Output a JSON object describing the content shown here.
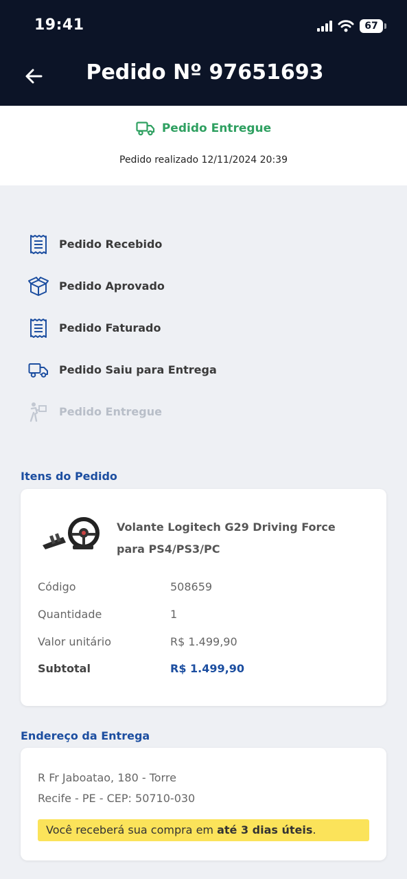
{
  "status_bar": {
    "time": "19:41",
    "battery": "67",
    "icons": [
      "signal-icon",
      "wifi-icon",
      "battery-icon"
    ]
  },
  "header": {
    "title": "Pedido Nº 97651693",
    "back_icon": "back-arrow-icon"
  },
  "order_status": {
    "label": "Pedido Entregue",
    "date_text": "Pedido realizado 12/11/2024 20:39",
    "color": "#2fa061"
  },
  "timeline": [
    {
      "label": "Pedido Recebido",
      "icon": "receipt-icon",
      "state": "done"
    },
    {
      "label": "Pedido Aprovado",
      "icon": "box-icon",
      "state": "done"
    },
    {
      "label": "Pedido Faturado",
      "icon": "invoice-icon",
      "state": "done"
    },
    {
      "label": "Pedido Saiu para Entrega",
      "icon": "truck-icon",
      "state": "done"
    },
    {
      "label": "Pedido Entregue",
      "icon": "delivery-person-icon",
      "state": "pending"
    }
  ],
  "items_section": {
    "title": "Itens do Pedido",
    "product": {
      "name_line1": "Volante Logitech G29 Driving Force",
      "name_line2": "para PS4/PS3/PC",
      "image": "steering-wheel-image"
    },
    "details": [
      {
        "key": "Código",
        "value": "508659"
      },
      {
        "key": "Quantidade",
        "value": "1"
      },
      {
        "key": "Valor unitário",
        "value": "R$ 1.499,90"
      }
    ],
    "subtotal": {
      "key": "Subtotal",
      "value": "R$ 1.499,90"
    }
  },
  "address_section": {
    "title": "Endereço da Entrega",
    "line1": "R Fr Jaboatao, 180 - Torre",
    "line2": "Recife - PE - CEP: 50710-030",
    "note_prefix": "Você receberá sua compra em ",
    "note_bold": "até 3 dias úteis",
    "note_suffix": "."
  },
  "colors": {
    "header_bg": "#0c1427",
    "accent_blue": "#1c4ea0",
    "success_green": "#2fa061",
    "highlight_yellow": "#fbe35a"
  }
}
